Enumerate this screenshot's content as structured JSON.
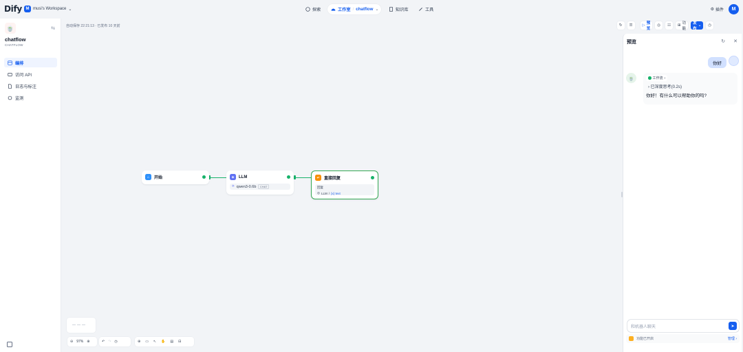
{
  "header": {
    "logo": "Dify",
    "workspace_badge": "M",
    "workspace_name": "musi's Workspace",
    "nav_explore": "探索",
    "nav_studio": "工作室",
    "nav_app": "chatflow",
    "nav_knowledge": "知识库",
    "nav_tools": "工具",
    "plugins": "插件",
    "avatar": "M"
  },
  "sidebar": {
    "app_name": "chatflow",
    "app_type": "CHATFLOW",
    "items": [
      {
        "label": "编排",
        "icon": "layout-icon"
      },
      {
        "label": "访问 API",
        "icon": "terminal-icon"
      },
      {
        "label": "日志与标注",
        "icon": "file-icon"
      },
      {
        "label": "监测",
        "icon": "monitor-icon"
      }
    ]
  },
  "canvas": {
    "autosave": "自动保存 22:21:13 · 已发布 10 天前",
    "nodes": {
      "start": {
        "title": "开始"
      },
      "llm": {
        "title": "LLM",
        "model": "qwen3-0.6b",
        "mode": "CHAT"
      },
      "answer": {
        "title": "直接回复",
        "label": "回复",
        "ref_node": "LLM",
        "ref_var": "{x} text"
      }
    },
    "zoom": "97%",
    "toolbar_buttons": {
      "preview": "预览",
      "features": "功能",
      "publish": "发布"
    }
  },
  "preview_panel": {
    "title": "预览",
    "user_message": "你好",
    "workflow_label": "工作流",
    "thinking": "已深度思考(0.2s)",
    "reply": "你好！有什么可以帮助你的吗?",
    "input_placeholder": "和机器人聊天",
    "features_enabled": "功能已开启",
    "manage": "管理"
  },
  "colors": {
    "accent": "#155eef",
    "success": "#17b26a",
    "answer_icon": "#f79009",
    "start_icon": "#2e90fa",
    "llm_icon": "#6172f3"
  }
}
